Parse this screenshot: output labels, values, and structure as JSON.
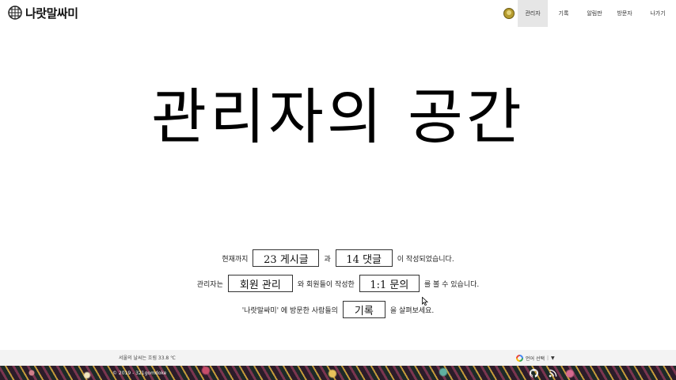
{
  "header": {
    "brand": "나랏말싸미",
    "nav": [
      {
        "label": "관리자",
        "active": true
      },
      {
        "label": "기록",
        "active": false
      },
      {
        "label": "알림판",
        "active": false
      },
      {
        "label": "방문자",
        "active": false
      },
      {
        "label": "나가기",
        "active": false
      }
    ]
  },
  "main": {
    "title": "관리자의 공간",
    "line1": {
      "prefix": "현재까지",
      "posts_button": "23 게시글",
      "connector": "과",
      "comments_button": "14 댓글",
      "suffix": "이 작성되었습니다."
    },
    "line2": {
      "prefix": "관리자는",
      "members_button": "회원 관리",
      "connector": "와 회원들이 작성한",
      "inquiry_button": "1:1 문의",
      "suffix": "를 볼 수 있습니다."
    },
    "line3": {
      "prefix": "'나랏말싸미' 에 방문한 사람들의",
      "records_button": "기록",
      "suffix": "을 살펴보세요."
    }
  },
  "footer": {
    "visitor_text": "서울의 날씨는 흐림 33.8 ℃",
    "translate_label": "언어 선택",
    "translate_arrow": "▼",
    "copyright": "© 2019 - 321gomdoke",
    "icons": [
      "github-icon",
      "blog-icon"
    ]
  },
  "colors": {
    "nav_active_bg": "#e6e6e6",
    "footer_bg": "#f3f3f3",
    "text": "#111111"
  }
}
